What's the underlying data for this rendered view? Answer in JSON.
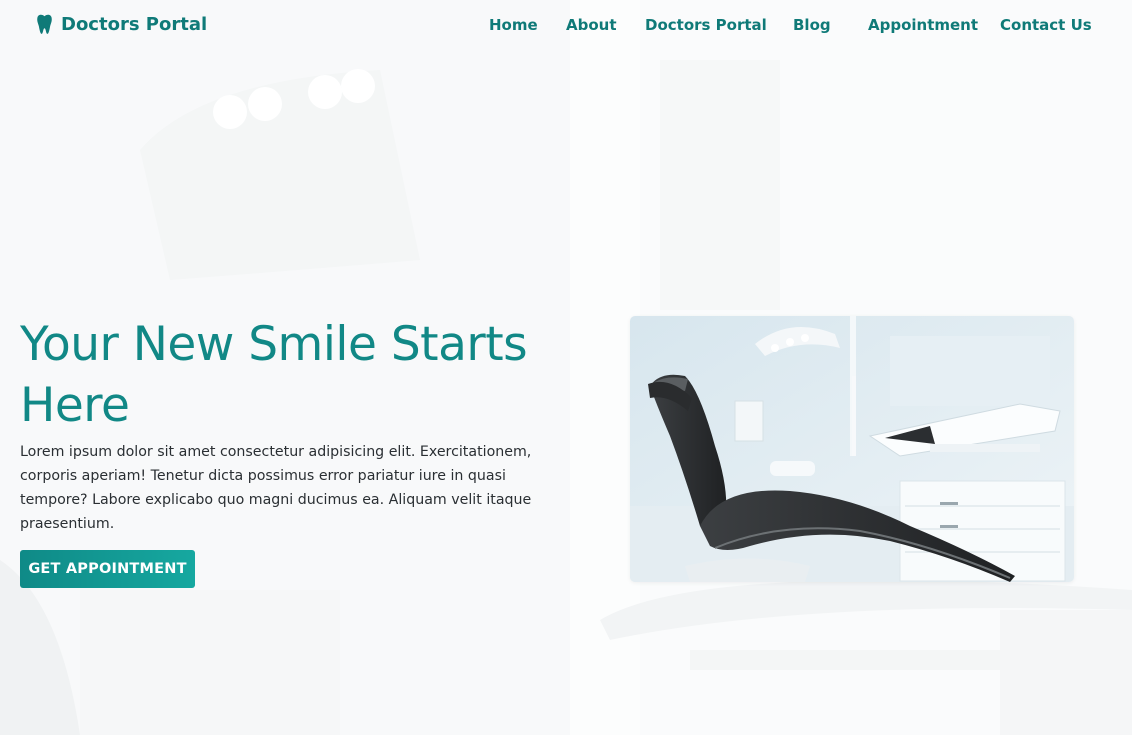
{
  "brand": {
    "name": "Doctors Portal",
    "icon": "tooth-icon"
  },
  "nav": {
    "items": [
      {
        "label": "Home"
      },
      {
        "label": "About"
      },
      {
        "label": "Doctors Portal"
      },
      {
        "label": "Blog"
      },
      {
        "label": "Appointment"
      },
      {
        "label": "Contact Us"
      }
    ]
  },
  "hero": {
    "title": "Your New Smile Starts Here",
    "description": "Lorem ipsum dolor sit amet consectetur adipisicing elit. Exercitationem, corporis aperiam! Tenetur dicta possimus error pariatur iure in quasi tempore? Labore explicabo quo magni ducimus ea. Aliquam velit itaque praesentium.",
    "cta_label": "GET APPOINTMENT"
  },
  "colors": {
    "brand": "#0f7a78",
    "title": "#118886",
    "button_start": "#0f8a87",
    "button_end": "#16a8a0",
    "background": "#f6f8f9"
  }
}
